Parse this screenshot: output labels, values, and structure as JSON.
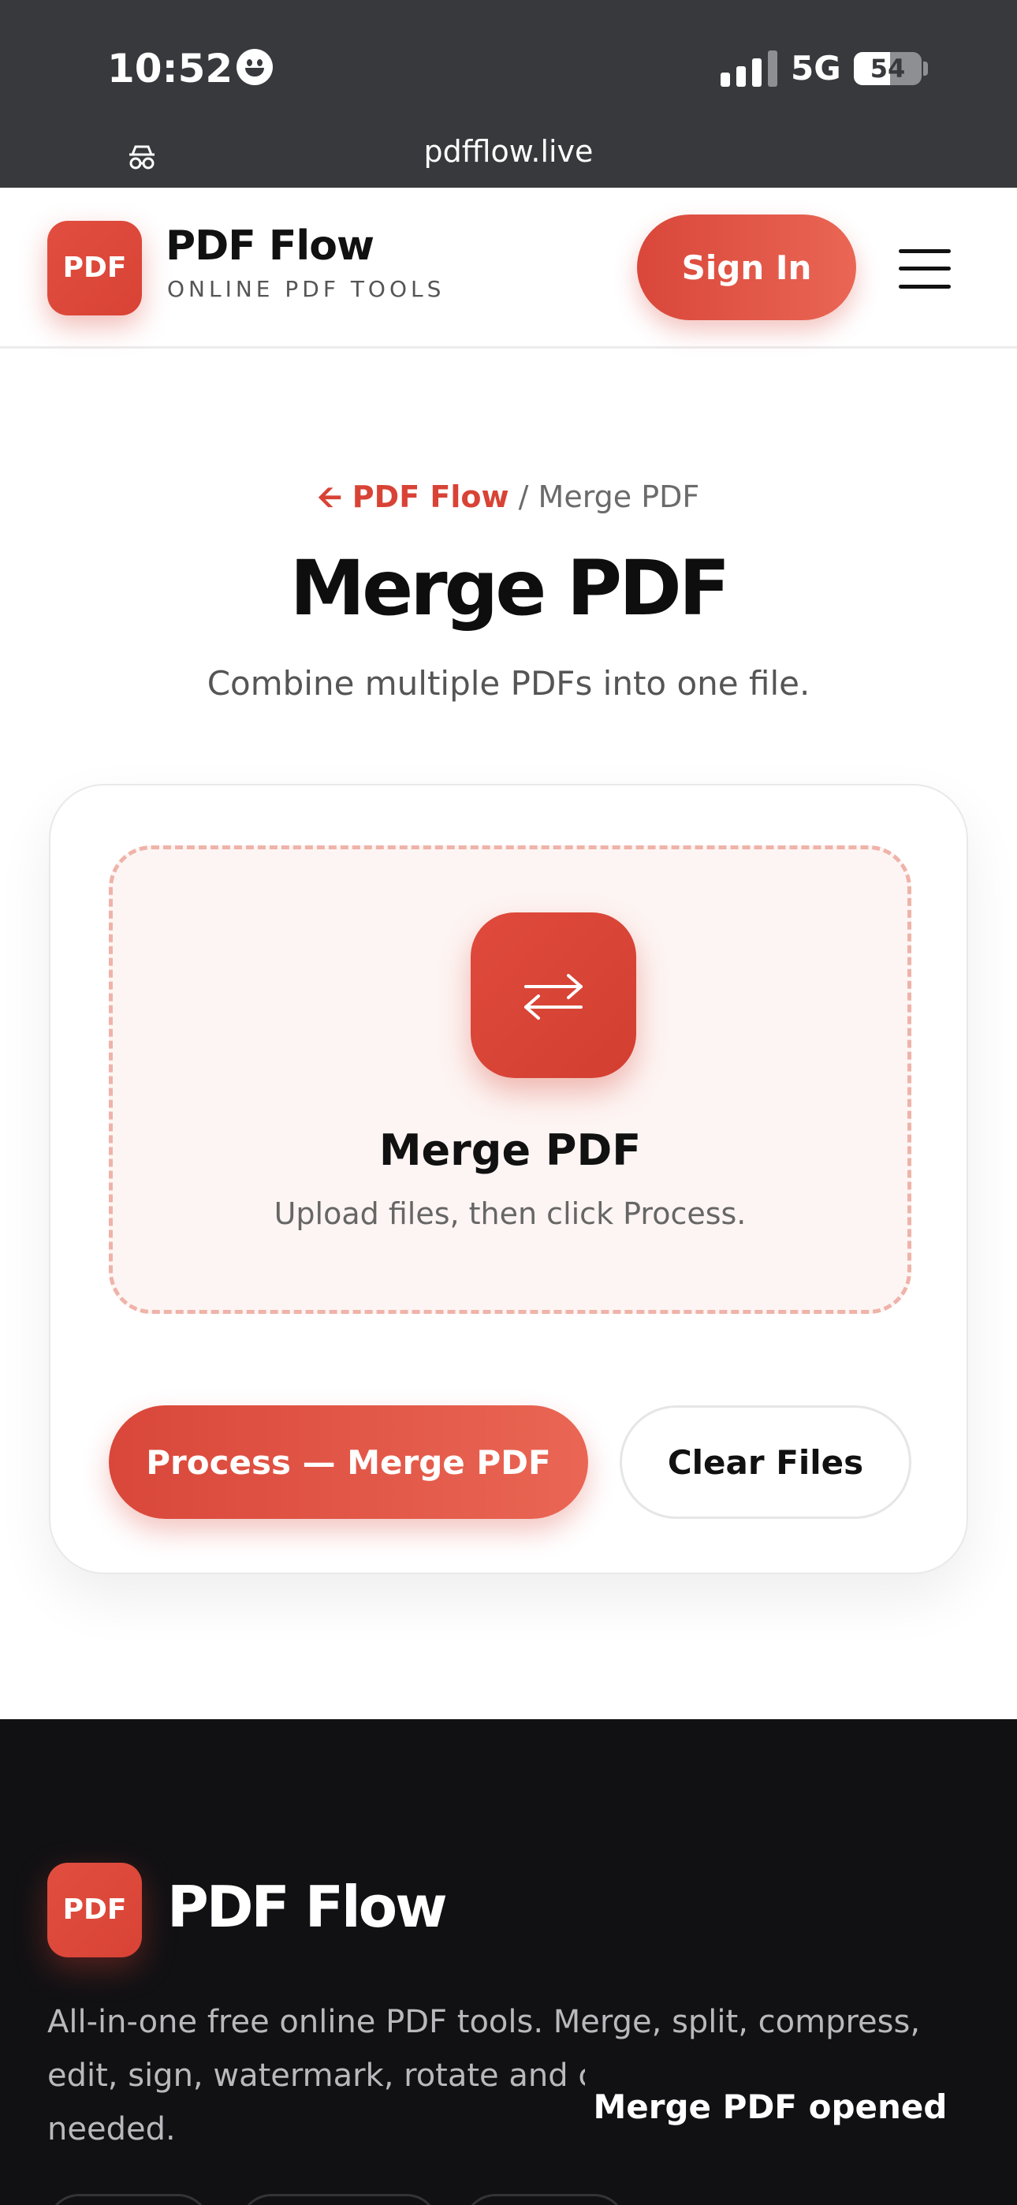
{
  "status_bar": {
    "time": "10:52",
    "network": "5G",
    "battery_level": "54",
    "battery_fraction": 0.54
  },
  "browser": {
    "url": "pdfflow.live"
  },
  "header": {
    "logo_text": "PDF",
    "brand_name": "PDF Flow",
    "tagline": "ONLINE PDF TOOLS",
    "signin_label": "Sign In"
  },
  "breadcrumb": {
    "back_label": "PDF Flow",
    "separator": " / ",
    "current": "Merge PDF"
  },
  "page": {
    "title": "Merge PDF",
    "subtitle": "Combine multiple PDFs into one file."
  },
  "dropzone": {
    "icon": "swap-arrows-icon",
    "title": "Merge PDF",
    "hint": "Upload files, then click Process."
  },
  "actions": {
    "process_label": "Process — Merge PDF",
    "clear_label": "Clear Files"
  },
  "footer": {
    "logo_text": "PDF",
    "brand_name": "PDF Flow",
    "description": "All-in-one free online PDF tools. Merge, split, compress, edit, sign, watermark, rotate and cc",
    "description_end": "needed."
  },
  "toast": {
    "message": "Merge PDF opened"
  },
  "colors": {
    "accent": "#d84335",
    "accent_light": "#ea6654",
    "footer_bg": "#111114",
    "status_bg": "#38393c"
  }
}
